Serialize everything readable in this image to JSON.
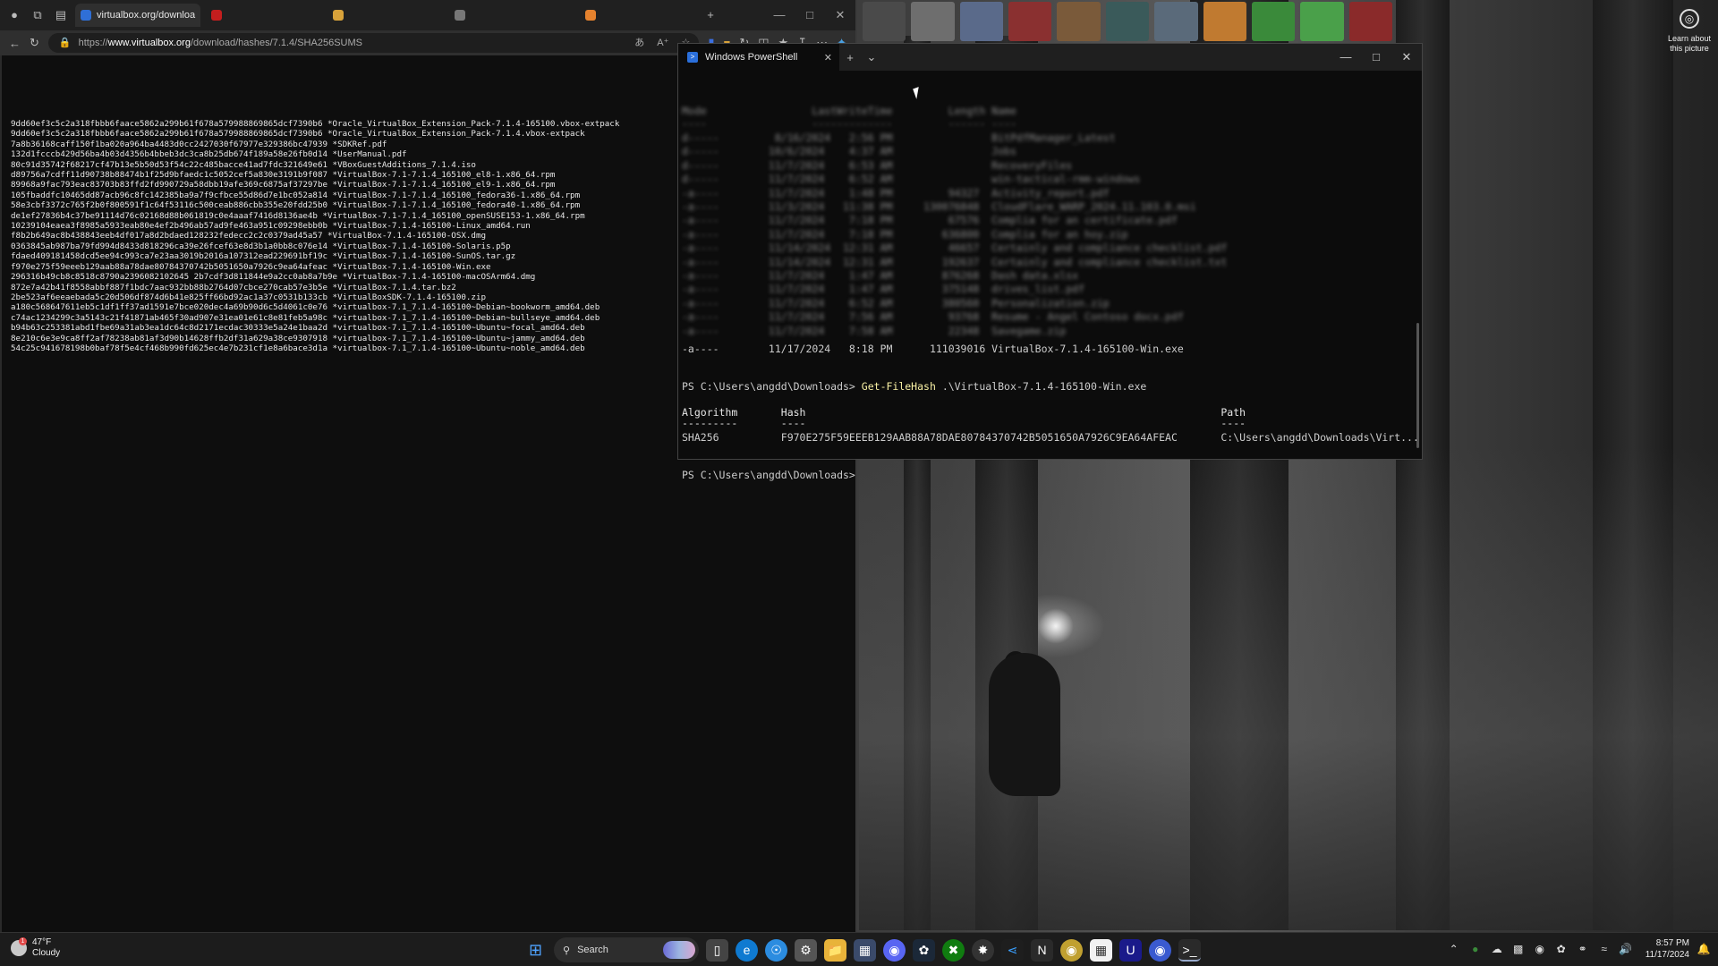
{
  "browser": {
    "tabs": [
      {
        "label": "virtualbox.org/downloa",
        "active": true,
        "color": "#2f6fd6"
      },
      {
        "label": "",
        "active": false,
        "color": "#c41e1e"
      },
      {
        "label": "",
        "active": false,
        "color": "#d8a23a"
      },
      {
        "label": "",
        "active": false,
        "color": "#777777"
      },
      {
        "label": "",
        "active": false,
        "color": "#e5822e"
      }
    ],
    "url_prefix": "https://",
    "url_host": "www.virtualbox.org",
    "url_path": "/download/hashes/7.1.4/SHA256SUMS",
    "hash_lines": [
      "9dd60ef3c5c2a318fbbb6faace5862a299b61f678a579988869865dcf7390b6 *Oracle_VirtualBox_Extension_Pack-7.1.4-165100.vbox-extpack",
      "9dd60ef3c5c2a318fbbb6faace5862a299b61f678a579988869865dcf7390b6 *Oracle_VirtualBox_Extension_Pack-7.1.4.vbox-extpack",
      "7a8b36168caff150f1ba020a964ba4483d0cc2427030f67977e329386bc47939 *SDKRef.pdf",
      "132d1fcccb429d56ba4b03d4356b4bbeb3dc3ca8b25db674f189a58e26fb0d14 *UserManual.pdf",
      "80c91d35742f68217cf47b13e5b50d53f54c22c485bacce41ad7fdc321649e61 *VBoxGuestAdditions_7.1.4.iso",
      "d89756a7cdff11d90738b88474b1f25d9bfaedc1c5052cef5a830e3191b9f087 *VirtualBox-7.1-7.1.4_165100_el8-1.x86_64.rpm",
      "89968a9fac793eac83703b83ffd2fd990729a58dbb19afe369c6875af37297be *VirtualBox-7.1-7.1.4_165100_el9-1.x86_64.rpm",
      "105fbaddfc10465dd87acb96c8fc142385ba9a7f9cfbce55d86d7e1bc052a814 *VirtualBox-7.1-7.1.4_165100_fedora36-1.x86_64.rpm",
      "58e3cbf3372c765f2b0f800591f1c64f53116c500ceab886cbb355e20fdd25b0 *VirtualBox-7.1-7.1.4_165100_fedora40-1.x86_64.rpm",
      "de1ef27836b4c37be91114d76c02168d88b061819c0e4aaaf7416d8136ae4b *VirtualBox-7.1-7.1.4_165100_openSUSE153-1.x86_64.rpm",
      "10239104eaea3f8985a5933eab80e4ef2b496ab57ad9fe463a951c09298ebb0b *VirtualBox-7.1.4-165100-Linux_amd64.run",
      "f8b2b649ac8b438843eeb4df017a8d2bdaed128232fedecc2c2c0379ad45a57 *VirtualBox-7.1.4-165100-OSX.dmg",
      "0363845ab987ba79fd994d8433d818296ca39e26fcef63e8d3b1a0bb8c076e14 *VirtualBox-7.1.4-165100-Solaris.p5p",
      "fdaed409181458dcd5ee94c993ca7e23aa3019b2016a107312ead229691bf19c *VirtualBox-7.1.4-165100-SunOS.tar.gz",
      "f970e275f59eeeb129aab88a78dae80784370742b5051650a7926c9ea64afeac *VirtualBox-7.1.4-165100-Win.exe",
      "296316b49cb8c8518c8790a2396082102645 2b7cdf3d811844e9a2cc0ab8a7b9e *VirtualBox-7.1.4-165100-macOSArm64.dmg",
      "872e7a42b41f8558abbf887f1bdc7aac932bb88b2764d07cbce270cab57e3b5e *VirtualBox-7.1.4.tar.bz2",
      "2be523af6eeaebada5c20d506df874d6b41e825ff66bd92ac1a37c0531b133cb *VirtualBoxSDK-7.1.4-165100.zip",
      "a180c568647611eb5c1df1ff37ad1591e7bce020dec4a69b90d6c5d4061c0e76 *virtualbox-7.1_7.1.4-165100~Debian~bookworm_amd64.deb",
      "c74ac1234299c3a5143c21f41871ab465f30ad907e31ea01e61c8e81feb5a98c *virtualbox-7.1_7.1.4-165100~Debian~bullseye_amd64.deb",
      "b94b63c253381abd1fbe69a31ab3ea1dc64c8d2171ecdac30333e5a24e1baa2d *virtualbox-7.1_7.1.4-165100~Ubuntu~focal_amd64.deb",
      "8e210c6e3e9ca8ff2af78238ab81af3d90b14628ffb2df31a629a38ce9307918 *virtualbox-7.1_7.1.4-165100~Ubuntu~jammy_amd64.deb",
      "54c25c941678198b0baf78f5e4cf468b990fd625ec4e7b231cf1e8a6bace3d1a *virtualbox-7.1_7.1.4-165100~Ubuntu~noble_amd64.deb"
    ]
  },
  "powershell": {
    "tab_title": "Windows PowerShell",
    "blurred_header": "Mode                 LastWriteTime         Length Name",
    "blurred_sep": "----                 -------------         ------ ----",
    "blurred_rows": [
      "d-----         8/16/2024   2:56 PM                BitPdfManager_Latest",
      "d-----        10/6/2024    4:37 AM                Jobs",
      "d-----        11/7/2024    6:53 AM                RecoveryFiles",
      "d-----        11/7/2024    6:52 AM                win-tactical-rmm-windows",
      "-a----        11/7/2024    1:48 PM         94327  Activity_report.pdf",
      "-a----        11/3/2024   11:38 PM     130076848  CloudFlare_WARP_2024.11.103.0.msi",
      "-a----        11/7/2024    7:18 PM         67576  Complia for an certificate.pdf",
      "-a----        11/7/2024    7:18 PM        636800  Complia for an hoy.zip",
      "-a----        11/14/2024  12:31 AM         46657  Certainly and compliance checklist.pdf",
      "-a----        11/14/2024  12:31 AM        192637  Certainly and compliance checklist.txt",
      "-a----        11/7/2024    1:47 AM        876268  Dash data.xlsx",
      "-a----        11/7/2024    1:47 AM        375148  drives_list.pdf",
      "-a----        11/7/2024    6:52 AM        380560  Personalization.zip",
      "-a----        11/7/2024    7:56 AM         93768  Resume - Angel Contoso docx.pdf",
      "-a----        11/7/2024    7:58 AM         22348  Savegame.zip"
    ],
    "file_row": "-a----        11/17/2024   8:18 PM      111039016 VirtualBox-7.1.4-165100-Win.exe",
    "prompt1": "PS C:\\Users\\angdd\\Downloads> ",
    "cmdlet": "Get-FileHash",
    "cmd_arg": " .\\VirtualBox-7.1.4-165100-Win.exe",
    "hash_header": "Algorithm       Hash                                                                   Path",
    "hash_sep": "---------       ----                                                                   ----",
    "hash_row": "SHA256          F970E275F59EEEB129AAB88A78DAE80784370742B5051650A7926C9EA64AFEAC       C:\\Users\\angdd\\Downloads\\Virt...",
    "prompt2": "PS C:\\Users\\angdd\\Downloads>"
  },
  "desktop": {
    "learn_label_1": "Learn about",
    "learn_label_2": "this picture"
  },
  "taskbar": {
    "weather_temp": "47°F",
    "weather_desc": "Cloudy",
    "weather_badge": "1",
    "search_label": "Search",
    "clock_time": "8:57 PM",
    "clock_date": "11/17/2024"
  }
}
